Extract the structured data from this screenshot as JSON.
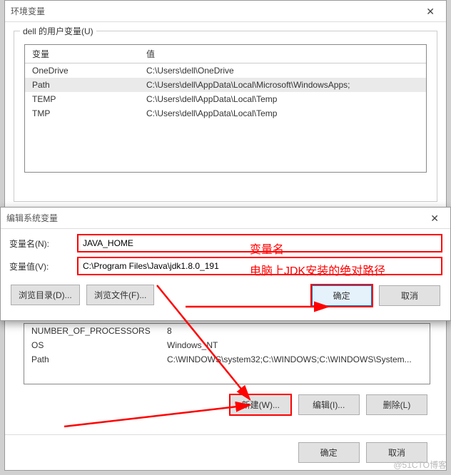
{
  "envvar_dialog": {
    "title": "环境变量",
    "user_group_label": "dell 的用户变量(U)",
    "columns": {
      "var": "变量",
      "val": "值"
    },
    "user_rows": [
      {
        "var": "OneDrive",
        "val": "C:\\Users\\dell\\OneDrive"
      },
      {
        "var": "Path",
        "val": "C:\\Users\\dell\\AppData\\Local\\Microsoft\\WindowsApps;"
      },
      {
        "var": "TEMP",
        "val": "C:\\Users\\dell\\AppData\\Local\\Temp"
      },
      {
        "var": "TMP",
        "val": "C:\\Users\\dell\\AppData\\Local\\Temp"
      }
    ],
    "sys_rows": [
      {
        "var": "NUMBER_OF_PROCESSORS",
        "val": "8"
      },
      {
        "var": "OS",
        "val": "Windows_NT"
      },
      {
        "var": "Path",
        "val": "C:\\WINDOWS\\system32;C:\\WINDOWS;C:\\WINDOWS\\System..."
      }
    ],
    "buttons": {
      "new": "新建(W)...",
      "edit": "编辑(I)...",
      "delete": "删除(L)",
      "ok": "确定",
      "cancel": "取消"
    }
  },
  "edit_dialog": {
    "title": "编辑系统变量",
    "name_label": "变量名(N):",
    "value_label": "变量值(V):",
    "name_value": "JAVA_HOME",
    "value_value": "C:\\Program Files\\Java\\jdk1.8.0_191",
    "buttons": {
      "browse_dir": "浏览目录(D)...",
      "browse_file": "浏览文件(F)...",
      "ok": "确定",
      "cancel": "取消"
    }
  },
  "annotations": {
    "name_note": "变量名",
    "value_note": "电脑上JDK安装的绝对路径"
  },
  "watermark": "@51CTO博客"
}
